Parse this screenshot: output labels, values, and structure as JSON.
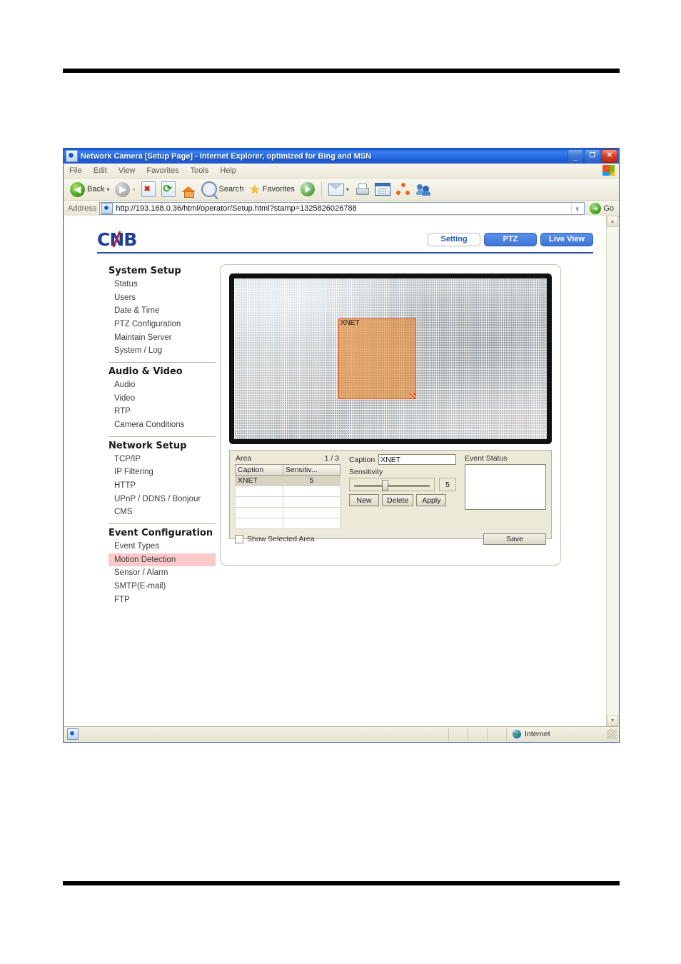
{
  "window": {
    "title": "Network Camera [Setup Page] - Internet Explorer, optimized for Bing and MSN",
    "minimize_label": "_",
    "maximize_label": "❐",
    "close_label": "✕"
  },
  "menubar": {
    "items": [
      "File",
      "Edit",
      "View",
      "Favorites",
      "Tools",
      "Help"
    ]
  },
  "toolbar": {
    "back_label": "Back",
    "forward_label": "",
    "dropdown_caret": "▾",
    "search_label": "Search",
    "favorites_label": "Favorites",
    "icons": [
      "back-icon",
      "forward-icon",
      "stop-icon",
      "refresh-icon",
      "home-icon",
      "search-icon",
      "favorites-icon",
      "media-icon",
      "mail-icon",
      "print-icon",
      "edit-icon",
      "discuss-icon",
      "messenger-icon"
    ]
  },
  "address_bar": {
    "label": "Address",
    "url": "http://193.168.0.36/html/operator/Setup.html?stamp=1325826026788",
    "dropdown_caret": "∨",
    "go_label": "Go",
    "go_arrow": "➜"
  },
  "page": {
    "logo_text": "CNB",
    "nav": [
      {
        "label": "Setting",
        "state": "active"
      },
      {
        "label": "PTZ",
        "state": "blue"
      },
      {
        "label": "Live View",
        "state": "blue"
      }
    ]
  },
  "sidebar": {
    "groups": [
      {
        "title": "System Setup",
        "items": [
          {
            "label": "Status",
            "selected": false
          },
          {
            "label": "Users",
            "selected": false
          },
          {
            "label": "Date & Time",
            "selected": false
          },
          {
            "label": "PTZ Configuration",
            "selected": false
          },
          {
            "label": "Maintain Server",
            "selected": false
          },
          {
            "label": "System / Log",
            "selected": false
          }
        ]
      },
      {
        "title": "Audio & Video",
        "items": [
          {
            "label": "Audio",
            "selected": false
          },
          {
            "label": "Video",
            "selected": false
          },
          {
            "label": "RTP",
            "selected": false
          },
          {
            "label": "Camera Conditions",
            "selected": false
          }
        ]
      },
      {
        "title": "Network Setup",
        "items": [
          {
            "label": "TCP/IP",
            "selected": false
          },
          {
            "label": "IP Filtering",
            "selected": false
          },
          {
            "label": "HTTP",
            "selected": false
          },
          {
            "label": "UPnP / DDNS / Bonjour",
            "selected": false
          },
          {
            "label": "CMS",
            "selected": false
          }
        ]
      },
      {
        "title": "Event Configuration",
        "items": [
          {
            "label": "Event Types",
            "selected": false
          },
          {
            "label": "Motion Detection",
            "selected": true
          },
          {
            "label": "Sensor / Alarm",
            "selected": false
          },
          {
            "label": "SMTP(E-mail)",
            "selected": false
          },
          {
            "label": "FTP",
            "selected": false
          }
        ]
      }
    ]
  },
  "video": {
    "region_label": "XNET",
    "grid_cols": 12,
    "grid_rows": 8,
    "region_color": "#e9892e",
    "region_border": "#f0520d"
  },
  "controls": {
    "area_label": "Area",
    "area_count": "1 / 3",
    "table": {
      "headers": [
        "Caption",
        "Sensitiv..."
      ],
      "rows": [
        {
          "caption": "XNET",
          "sensitivity": "5",
          "selected": true
        },
        {
          "caption": "",
          "sensitivity": "",
          "selected": false
        },
        {
          "caption": "",
          "sensitivity": "",
          "selected": false
        },
        {
          "caption": "",
          "sensitivity": "",
          "selected": false
        },
        {
          "caption": "",
          "sensitivity": "",
          "selected": false
        }
      ]
    },
    "caption_label": "Caption",
    "caption_value": "XNET",
    "sensitivity_label": "Sensitivity",
    "sensitivity_value": "5",
    "buttons": {
      "new": "New",
      "delete": "Delete",
      "apply": "Apply",
      "save": "Save"
    },
    "event_status_label": "Event Status",
    "show_selected_area_label": "Show Selected Area",
    "show_selected_area_checked": false
  },
  "statusbar": {
    "zone_label": "Internet"
  },
  "scrollbar": {
    "up_arrow": "▲",
    "down_arrow": "▼"
  }
}
